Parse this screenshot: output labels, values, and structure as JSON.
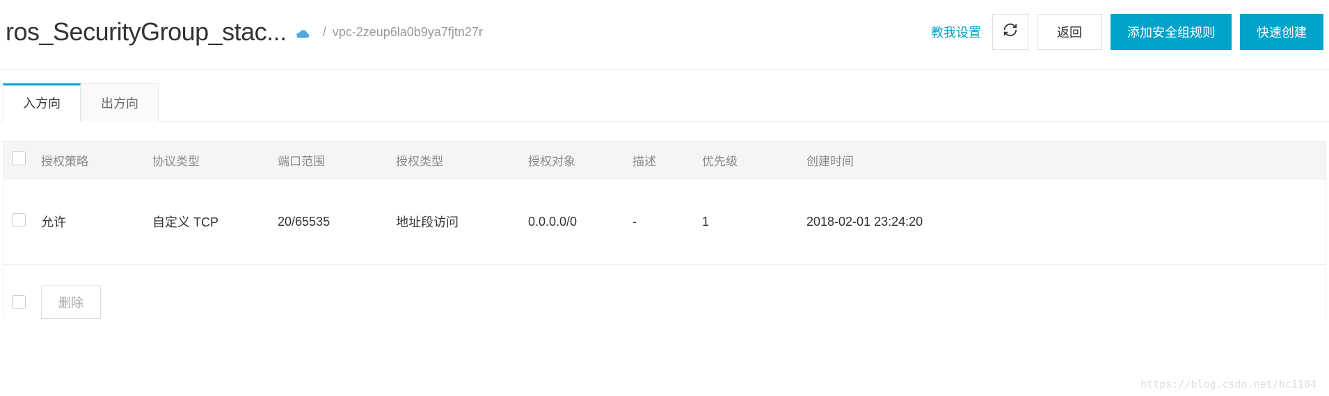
{
  "header": {
    "title": "ros_SecurityGroup_stac...",
    "breadcrumb": "vpc-2zeup6la0b9ya7fjtn27r",
    "help_link": "教我设置",
    "back_btn": "返回",
    "add_rule_btn": "添加安全组规则",
    "quick_create_btn": "快速创建"
  },
  "tabs": {
    "inbound": "入方向",
    "outbound": "出方向"
  },
  "table": {
    "headers": {
      "policy": "授权策略",
      "protocol": "协议类型",
      "port": "端口范围",
      "authtype": "授权类型",
      "target": "授权对象",
      "desc": "描述",
      "priority": "优先级",
      "time": "创建时间"
    },
    "rows": [
      {
        "policy": "允许",
        "protocol": "自定义 TCP",
        "port": "20/65535",
        "authtype": "地址段访问",
        "target": "0.0.0.0/0",
        "desc": "-",
        "priority": "1",
        "time": "2018-02-01 23:24:20"
      }
    ]
  },
  "footer": {
    "delete_btn": "删除"
  },
  "watermark": "https://blog.csdn.net/hc1104"
}
